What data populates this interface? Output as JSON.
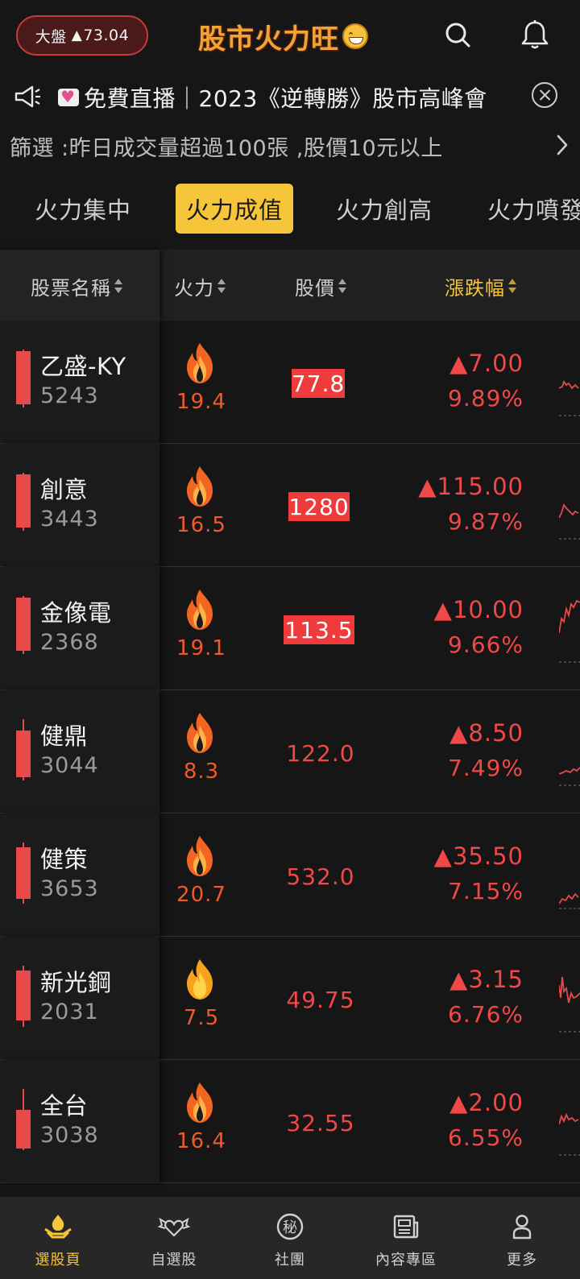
{
  "header": {
    "market_label": "大盤",
    "market_change": "73.04",
    "app_title": "股市火力旺"
  },
  "announcement": {
    "text": "免費直播｜2023《逆轉勝》股市高峰會"
  },
  "filter": {
    "text": "篩選 :昨日成交量超過100張 ,股價10元以上"
  },
  "tabs": [
    {
      "label": "火力集中",
      "active": false
    },
    {
      "label": "火力成值",
      "active": true
    },
    {
      "label": "火力創高",
      "active": false
    },
    {
      "label": "火力噴發",
      "active": false
    }
  ],
  "columns": {
    "name": "股票名稱",
    "fire": "火力",
    "price": "股價",
    "change": "漲跌幅"
  },
  "stocks": [
    {
      "name": "乙盛-KY",
      "code": "5243",
      "fire": "19.4",
      "price": "77.8",
      "price_highlight": true,
      "change": "▲7.00",
      "pct": "9.89%"
    },
    {
      "name": "創意",
      "code": "3443",
      "fire": "16.5",
      "price": "1280",
      "price_highlight": true,
      "change": "▲115.00",
      "pct": "9.87%"
    },
    {
      "name": "金像電",
      "code": "2368",
      "fire": "19.1",
      "price": "113.5",
      "price_highlight": true,
      "change": "▲10.00",
      "pct": "9.66%"
    },
    {
      "name": "健鼎",
      "code": "3044",
      "fire": "8.3",
      "price": "122.0",
      "price_highlight": false,
      "change": "▲8.50",
      "pct": "7.49%"
    },
    {
      "name": "健策",
      "code": "3653",
      "fire": "20.7",
      "price": "532.0",
      "price_highlight": false,
      "change": "▲35.50",
      "pct": "7.15%"
    },
    {
      "name": "新光鋼",
      "code": "2031",
      "fire": "7.5",
      "price": "49.75",
      "price_highlight": false,
      "change": "▲3.15",
      "pct": "6.76%"
    },
    {
      "name": "全台",
      "code": "3038",
      "fire": "16.4",
      "price": "32.55",
      "price_highlight": false,
      "change": "▲2.00",
      "pct": "6.55%"
    }
  ],
  "bottom_nav": [
    {
      "label": "選股頁",
      "icon": "stock-pick-icon",
      "active": true
    },
    {
      "label": "自選股",
      "icon": "winged-heart-icon",
      "active": false
    },
    {
      "label": "社團",
      "icon": "secret-circle-icon",
      "active": false
    },
    {
      "label": "內容專區",
      "icon": "newspaper-icon",
      "active": false
    },
    {
      "label": "更多",
      "icon": "person-icon",
      "active": false
    }
  ],
  "colors": {
    "accent": "#f7c53a",
    "up_red": "#f04848",
    "fire_orange": "#f05a2a",
    "background": "#161616"
  }
}
